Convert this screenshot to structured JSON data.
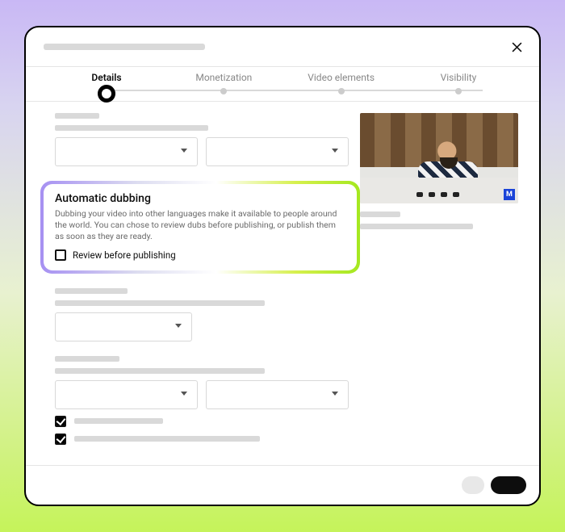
{
  "stepper": {
    "steps": [
      {
        "label": "Details",
        "active": true
      },
      {
        "label": "Monetization",
        "active": false
      },
      {
        "label": "Video elements",
        "active": false
      },
      {
        "label": "Visibility",
        "active": false
      }
    ]
  },
  "dubbing": {
    "title": "Automatic dubbing",
    "desc": "Dubbing your video into other languages make it available to people around the world. You can chose to review dubs before publishing, or publish them as soon as they are ready.",
    "checkbox_label": "Review before publishing",
    "checked": false
  },
  "thumbnail": {
    "badge": "M"
  }
}
